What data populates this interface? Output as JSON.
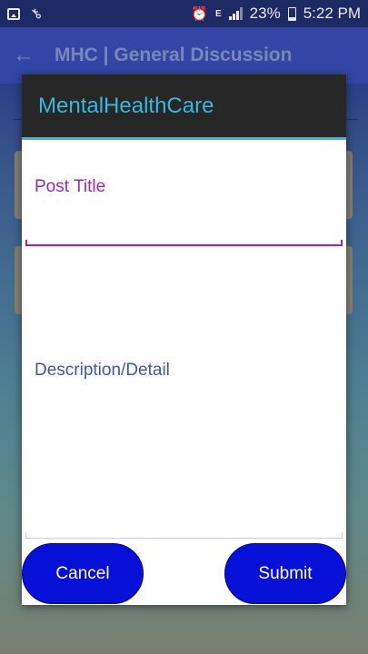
{
  "status_bar": {
    "battery": "23%",
    "time": "5:22 PM",
    "network_label": "E",
    "icons": [
      "image-icon",
      "key-icon",
      "alarm-icon",
      "network-icon",
      "signal-icon",
      "battery-icon"
    ]
  },
  "app_bar": {
    "back_icon": "←",
    "title": "MHC | General Discussion"
  },
  "dialog": {
    "title": "MentalHealthCare",
    "post_title_label": "Post Title",
    "description_label": "Description/Detail",
    "cancel_label": "Cancel",
    "submit_label": "Submit"
  },
  "colors": {
    "accent": "#35b7de",
    "button": "#0710d6",
    "title_field": "#9c27b0",
    "description_label": "#3d5aa8"
  }
}
